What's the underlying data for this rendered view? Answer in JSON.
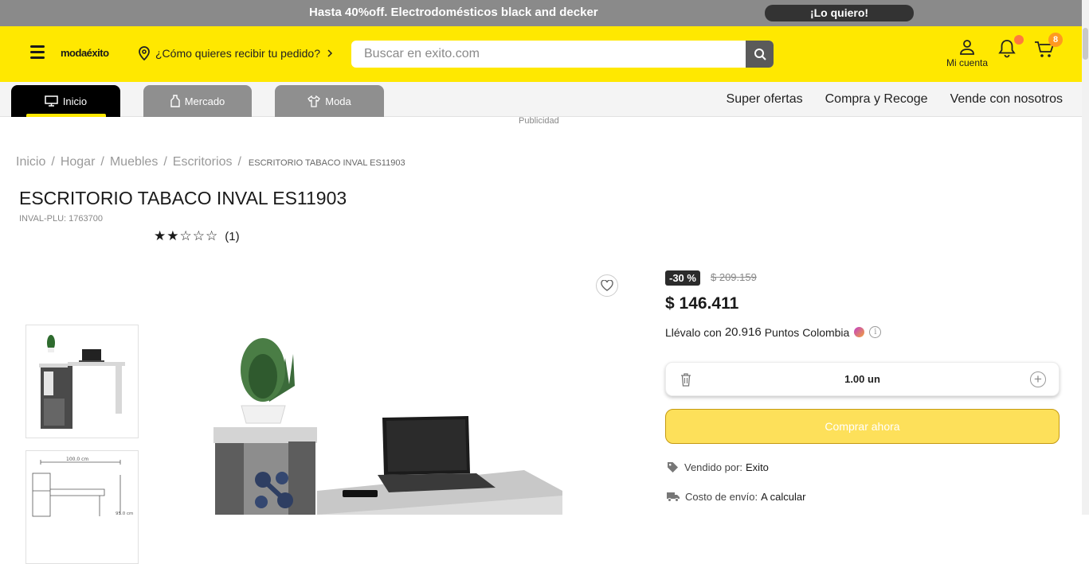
{
  "promo": {
    "text": "Hasta 40%off. Electrodomésticos black and decker",
    "button": "¡Lo quiero!"
  },
  "header": {
    "logo": "modaéxito",
    "delivery": "¿Cómo quieres recibir tu pedido?",
    "search_placeholder": "Buscar en exito.com",
    "account_label": "Mi cuenta",
    "cart_count": "8"
  },
  "nav": {
    "tabs": [
      {
        "label": "Inicio"
      },
      {
        "label": "Mercado"
      },
      {
        "label": "Moda"
      }
    ],
    "links": [
      "Super ofertas",
      "Compra y Recoge",
      "Vende con nosotros"
    ]
  },
  "publicidad": "Publicidad",
  "breadcrumb": {
    "items": [
      "Inicio",
      "Hogar",
      "Muebles",
      "Escritorios"
    ],
    "current": "ESCRITORIO TABACO INVAL ES11903"
  },
  "product": {
    "title": "ESCRITORIO TABACO INVAL ES11903",
    "plu": "INVAL-PLU: 1763700",
    "rating_stars": 2,
    "rating_max": 5,
    "rating_count": "(1)",
    "discount": "-30 %",
    "old_price": "$ 209.159",
    "price": "$ 146.411",
    "points_prefix": "Llévalo con",
    "points_value": "20.916",
    "points_suffix": "Puntos Colombia",
    "quantity": "1.00 un",
    "buy_label": "Comprar ahora",
    "seller_label": "Vendido por:",
    "seller": "Exito",
    "shipping_label": "Costo de envío:",
    "shipping": "A calcular"
  },
  "icons": {
    "menu": "hamburger-icon",
    "location": "location-pin-icon",
    "search": "search-icon",
    "user": "user-icon",
    "bell": "bell-icon",
    "cart": "cart-icon",
    "heart": "heart-icon",
    "trash": "trash-icon",
    "plus": "plus-circle-icon",
    "tag": "tag-icon",
    "truck": "truck-icon"
  },
  "colors": {
    "brand_yellow": "#ffe800",
    "buy_button": "#fde05a",
    "badge_orange": "#ff9a1f"
  }
}
